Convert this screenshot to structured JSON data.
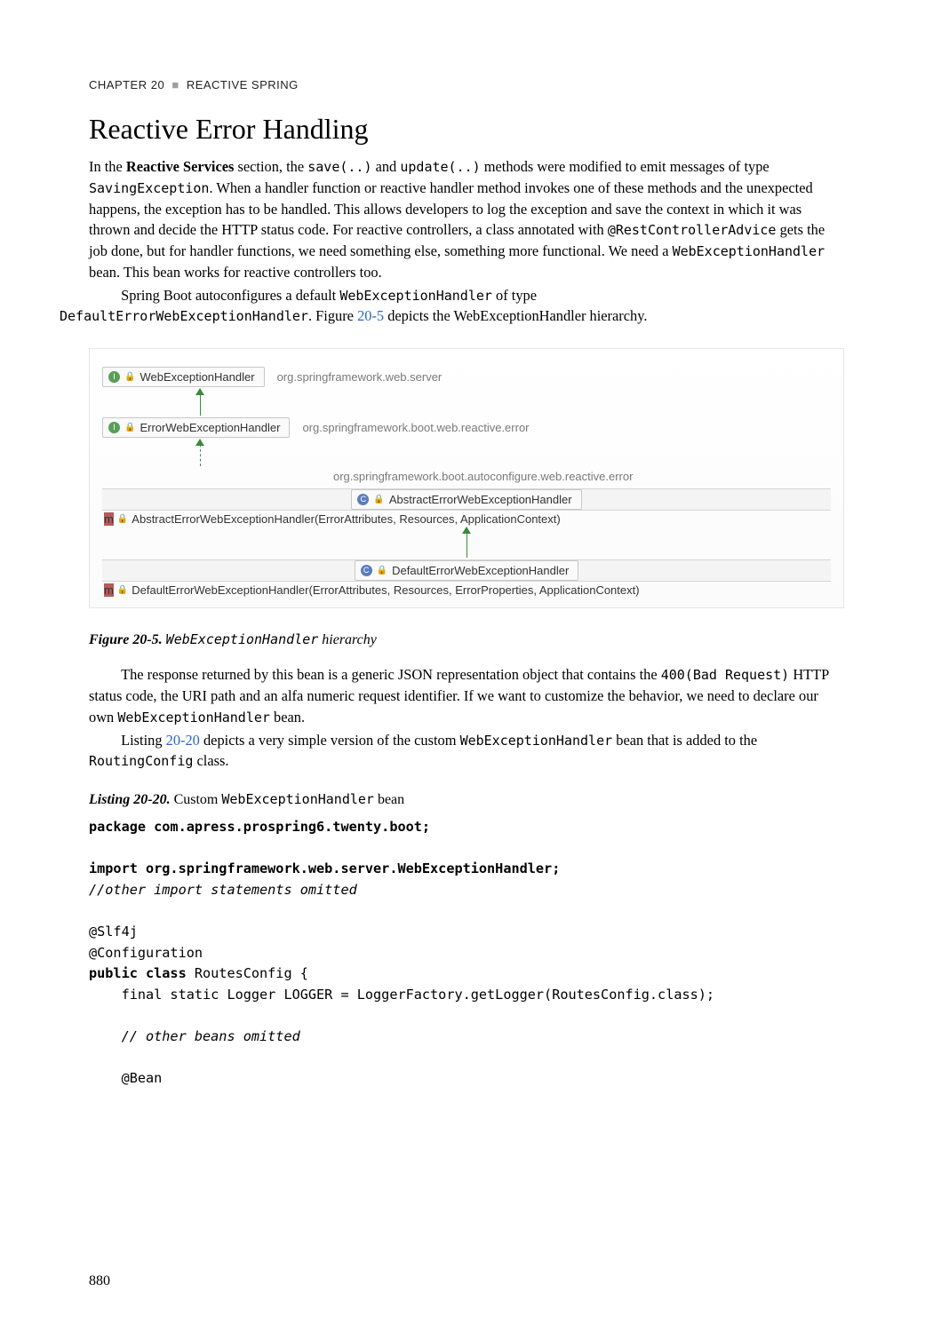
{
  "header": {
    "chapter": "CHAPTER 20",
    "title": "REACTIVE SPRING"
  },
  "section_title": "Reactive Error Handling",
  "p1_a": "In the ",
  "p1_bold": "Reactive Services",
  "p1_b": " section, the ",
  "p1_c1": "save(..)",
  "p1_c": " and ",
  "p1_c2": "update(..)",
  "p1_d": " methods were modified to emit messages of type ",
  "p1_c3": "SavingException",
  "p1_e": ". When a handler function or reactive handler method invokes one of these methods and the unexpected happens, the exception has to be handled. This allows developers to log the exception and save the context in which it was thrown and decide the HTTP status code. For reactive controllers, a class annotated with ",
  "p1_c4": "@RestControllerAdvice",
  "p1_f": " gets the job done, but for handler functions, we need something else, something more functional. We need a ",
  "p1_c5": "WebExceptionHandler",
  "p1_g": " bean. This bean works for reactive controllers too.",
  "p2_a": "Spring Boot autoconfigures a default ",
  "p2_c1": "WebExceptionHandler",
  "p2_b": " of type ",
  "p2_c2": "DefaultErrorWebExceptionHandler",
  "p2_c": ". Figure ",
  "p2_link": "20-5",
  "p2_d": " depicts the WebExceptionHandler hierarchy.",
  "diagram": {
    "row1": {
      "name": "WebExceptionHandler",
      "pkg": "org.springframework.web.server"
    },
    "row2": {
      "name": "ErrorWebExceptionHandler",
      "pkg": "org.springframework.boot.web.reactive.error"
    },
    "pkg3": "org.springframework.boot.autoconfigure.web.reactive.error",
    "row3": {
      "name": "AbstractErrorWebExceptionHandler"
    },
    "m3": "AbstractErrorWebExceptionHandler(ErrorAttributes, Resources, ApplicationContext)",
    "row4": {
      "name": "DefaultErrorWebExceptionHandler"
    },
    "m4": "DefaultErrorWebExceptionHandler(ErrorAttributes, Resources, ErrorProperties, ApplicationContext)"
  },
  "fig": {
    "lead": "Figure 20-5.",
    "mono": "WebExceptionHandler",
    "plain": "hierarchy"
  },
  "p3_a": "The response returned by this bean is a generic JSON representation object that contains the ",
  "p3_c1": "400(Bad Request)",
  "p3_b": " HTTP status code, the URI path and an alfa numeric request identifier. If we want to customize the behavior, we need to declare our own ",
  "p3_c2": "WebExceptionHandler",
  "p3_c": " bean.",
  "p4_a": "Listing ",
  "p4_link": "20-20",
  "p4_b": " depicts a very simple version of the custom ",
  "p4_c1": "WebExceptionHandler",
  "p4_c": " bean that is added to the ",
  "p4_c2": "RoutingConfig",
  "p4_d": " class.",
  "listing": {
    "lead": "Listing 20-20.",
    "plain1": "Custom ",
    "mono": "WebExceptionHandler",
    "plain2": " bean"
  },
  "code": {
    "l1b": "package com.apress.prospring6.twenty.boot;",
    "l2b": "import org.springframework.web.server.WebExceptionHandler;",
    "l3i": "//other import statements omitted",
    "l4": "@Slf4j",
    "l5": "@Configuration",
    "l6b": "public class ",
    "l6": "RoutesConfig {",
    "l7": "    final static Logger LOGGER = LoggerFactory.getLogger(RoutesConfig.class);",
    "l8i": "    // other beans omitted",
    "l9": "    @Bean"
  },
  "pagenum": "880"
}
